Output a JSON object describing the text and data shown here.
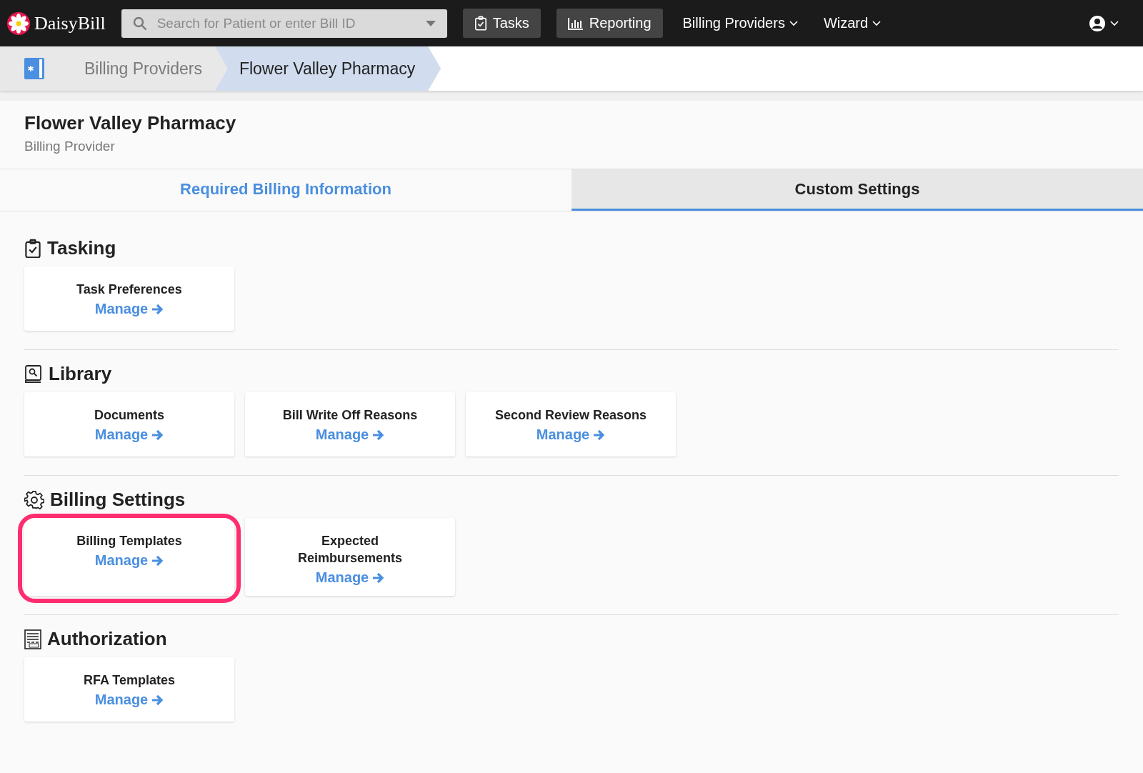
{
  "top_bar": {
    "logo": "DaisyBill",
    "search": {
      "placeholder": "Search for Patient or enter Bill ID"
    },
    "nav": [
      {
        "kind": "button",
        "label": "Tasks"
      },
      {
        "kind": "button",
        "label": "Reporting"
      },
      {
        "kind": "dropdown",
        "label": "Billing Providers"
      },
      {
        "kind": "dropdown",
        "label": "Wizard"
      }
    ]
  },
  "breadcrumb": [
    {
      "label": "Billing Providers",
      "selected": false
    },
    {
      "label": "Flower Valley Pharmacy",
      "selected": true
    }
  ],
  "header": {
    "title": "Flower Valley Pharmacy",
    "subtitle": "Billing Provider"
  },
  "tabs": [
    {
      "label": "Required Billing Information",
      "selected": false
    },
    {
      "label": "Custom Settings",
      "selected": true
    }
  ],
  "sections": [
    {
      "title": "Tasking",
      "cards": [
        {
          "title": "Task Preferences",
          "link": "Manage",
          "highlighted": false
        }
      ]
    },
    {
      "title": "Library",
      "cards": [
        {
          "title": "Documents",
          "link": "Manage",
          "highlighted": false
        },
        {
          "title": "Bill Write Off Reasons",
          "link": "Manage",
          "highlighted": false
        },
        {
          "title": "Second Review Reasons",
          "link": "Manage",
          "highlighted": false
        }
      ]
    },
    {
      "title": "Billing Settings",
      "cards": [
        {
          "title": "Billing Templates",
          "link": "Manage",
          "highlighted": true
        },
        {
          "title": "Expected Reimbursements",
          "link": "Manage",
          "highlighted": false
        }
      ]
    },
    {
      "title": "Authorization",
      "cards": [
        {
          "title": "RFA Templates",
          "link": "Manage",
          "highlighted": false
        }
      ]
    }
  ]
}
